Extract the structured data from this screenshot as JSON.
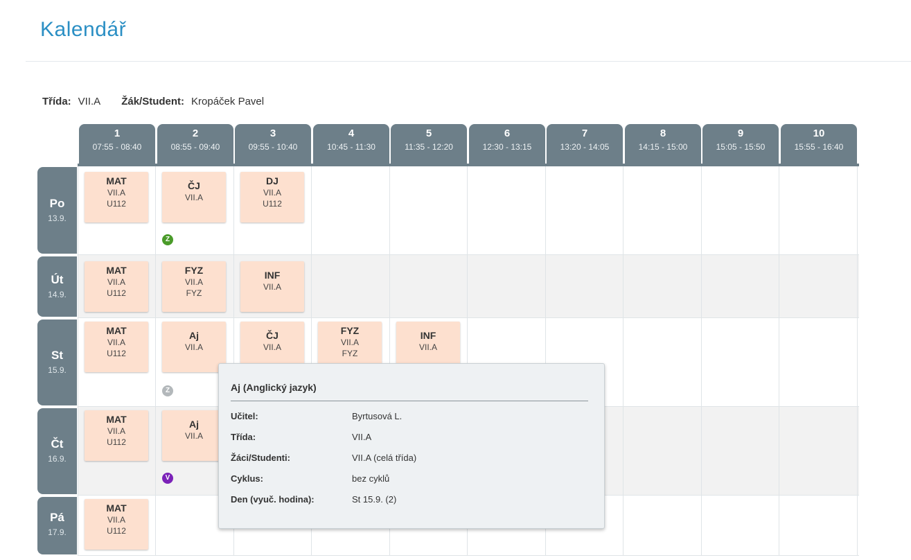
{
  "page": {
    "title": "Kalendář"
  },
  "info": {
    "class_label": "Třída:",
    "class_value": "VII.A",
    "student_label": "Žák/Student:",
    "student_value": "Kropáček Pavel"
  },
  "periods": [
    {
      "num": "1",
      "time": "07:55 - 08:40"
    },
    {
      "num": "2",
      "time": "08:55 - 09:40"
    },
    {
      "num": "3",
      "time": "09:55 - 10:40"
    },
    {
      "num": "4",
      "time": "10:45 - 11:30"
    },
    {
      "num": "5",
      "time": "11:35 - 12:20"
    },
    {
      "num": "6",
      "time": "12:30 - 13:15"
    },
    {
      "num": "7",
      "time": "13:20 - 14:05"
    },
    {
      "num": "8",
      "time": "14:15 - 15:00"
    },
    {
      "num": "9",
      "time": "15:05 - 15:50"
    },
    {
      "num": "10",
      "time": "15:55 - 16:40"
    }
  ],
  "days": [
    {
      "name": "Po",
      "date": "13.9."
    },
    {
      "name": "Út",
      "date": "14.9."
    },
    {
      "name": "St",
      "date": "15.9."
    },
    {
      "name": "Čt",
      "date": "16.9."
    },
    {
      "name": "Pá",
      "date": "17.9."
    }
  ],
  "lessons": {
    "po_1": {
      "subject": "MAT",
      "class": "VII.A",
      "room": "U112"
    },
    "po_2": {
      "subject": "ČJ",
      "class": "VII.A"
    },
    "po_3": {
      "subject": "DJ",
      "class": "VII.A",
      "room": "U112"
    },
    "ut_1": {
      "subject": "MAT",
      "class": "VII.A",
      "room": "U112"
    },
    "ut_2": {
      "subject": "FYZ",
      "class": "VII.A",
      "room": "FYZ"
    },
    "ut_3": {
      "subject": "INF",
      "class": "VII.A"
    },
    "st_1": {
      "subject": "MAT",
      "class": "VII.A",
      "room": "U112"
    },
    "st_2": {
      "subject": "Aj",
      "class": "VII.A"
    },
    "st_3": {
      "subject": "ČJ",
      "class": "VII.A"
    },
    "st_4": {
      "subject": "FYZ",
      "class": "VII.A",
      "room": "FYZ"
    },
    "st_5": {
      "subject": "INF",
      "class": "VII.A"
    },
    "ct_1": {
      "subject": "MAT",
      "class": "VII.A",
      "room": "U112"
    },
    "ct_2": {
      "subject": "Aj",
      "class": "VII.A"
    },
    "pa_1": {
      "subject": "MAT",
      "class": "VII.A",
      "room": "U112"
    }
  },
  "badges": {
    "po_2": {
      "letter": "Z",
      "color": "#4a9b2a"
    },
    "st_2": {
      "letter": "Z",
      "color": "#b3b8bb"
    },
    "ct_2": {
      "letter": "V",
      "color": "#7b22b8"
    }
  },
  "tooltip": {
    "title": "Aj (Anglický jazyk)",
    "teacher_label": "Učitel:",
    "teacher_value": "Byrtusová L.",
    "class_label": "Třída:",
    "class_value": "VII.A",
    "students_label": "Žáci/Studenti:",
    "students_value": "VII.A (celá třída)",
    "cycle_label": "Cyklus:",
    "cycle_value": "bez cyklů",
    "day_label": "Den (vyuč. hodina):",
    "day_value": "St 15.9. (2)"
  },
  "colors": {
    "accent": "#2b8fc4",
    "header": "#6d7f89",
    "lesson": "#fde0cf"
  }
}
